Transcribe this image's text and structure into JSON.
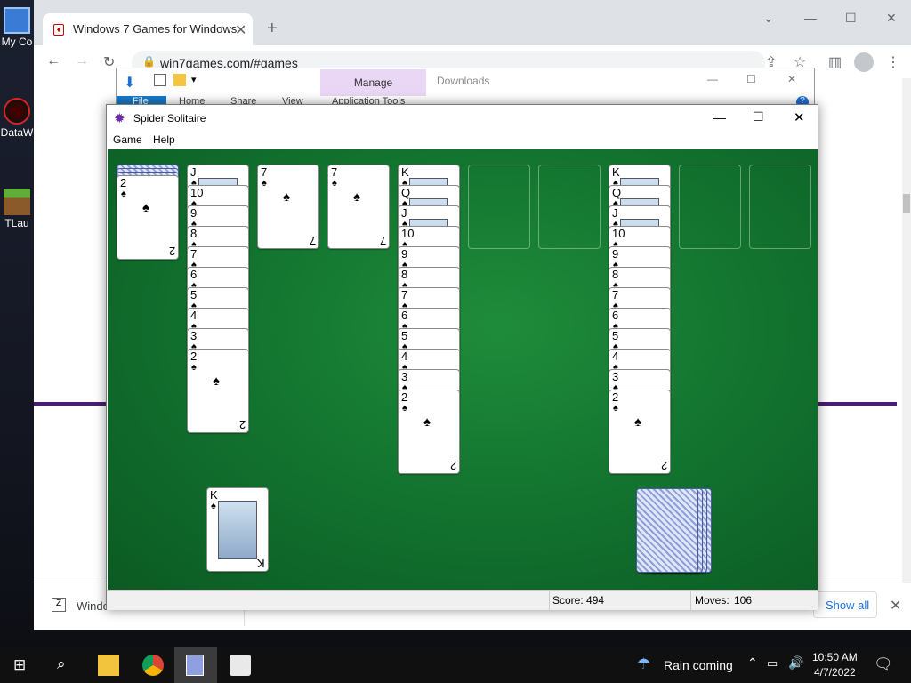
{
  "desktop": {
    "icons": [
      {
        "label": "My Co",
        "icon": "computer-icon"
      },
      {
        "label": "DataW",
        "icon": "datawrangler-icon"
      },
      {
        "label": "TLau",
        "icon": "tlauncher-icon"
      }
    ]
  },
  "browser": {
    "tab_title": "Windows 7 Games for Windows",
    "url": "win7games.com/#games",
    "download_item": "Windo",
    "show_all": "Show all"
  },
  "explorer": {
    "manage": "Manage",
    "downloads": "Downloads",
    "ribbon": [
      "File",
      "Home",
      "Share",
      "View",
      "Application Tools"
    ]
  },
  "solitaire": {
    "title": "Spider Solitaire",
    "menu": [
      "Game",
      "Help"
    ],
    "score_label": "Score: 494",
    "moves_label": "Moves:",
    "moves_value": "106",
    "felt_color": "#137530",
    "columns": [
      {
        "hidden": 3,
        "cards": [
          "2"
        ]
      },
      {
        "hidden": 0,
        "cards": [
          "J",
          "10",
          "9",
          "8",
          "7",
          "6",
          "5",
          "4",
          "3",
          "2"
        ]
      },
      {
        "hidden": 0,
        "cards": [
          "7"
        ]
      },
      {
        "hidden": 0,
        "cards": [
          "7"
        ]
      },
      {
        "hidden": 0,
        "cards": [
          "K",
          "Q",
          "J",
          "10",
          "9",
          "8",
          "7",
          "6",
          "5",
          "4",
          "3",
          "2"
        ]
      },
      {
        "hidden": 0,
        "cards": []
      },
      {
        "hidden": 0,
        "cards": []
      },
      {
        "hidden": 0,
        "cards": [
          "K",
          "Q",
          "J",
          "10",
          "9",
          "8",
          "7",
          "6",
          "5",
          "4",
          "3",
          "2"
        ]
      },
      {
        "hidden": 0,
        "cards": []
      },
      {
        "hidden": 0,
        "cards": []
      }
    ],
    "completed_foundation": "K",
    "stock_piles": 4,
    "suit_symbol": "♠"
  },
  "taskbar": {
    "weather": "Rain coming",
    "time": "10:50 AM",
    "date": "4/7/2022"
  }
}
